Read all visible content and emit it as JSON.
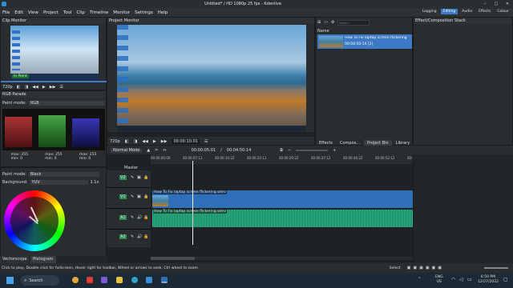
{
  "window": {
    "title": "Untitled* / HD 1080p 25 fps - Kdenlive"
  },
  "menu": [
    "File",
    "Edit",
    "View",
    "Project",
    "Tool",
    "Clip",
    "Timeline",
    "Monitor",
    "Settings",
    "Help"
  ],
  "workspaces": [
    "Logging",
    "Editing",
    "Audio",
    "Effects",
    "Colour"
  ],
  "workspace_active": "Editing",
  "clip_monitor": {
    "title": "Clip Monitor",
    "zoom": "720p",
    "overlay": "In Point"
  },
  "project_monitor": {
    "title": "Project Monitor",
    "zoom": "720p",
    "timecode": "00:00:10:01"
  },
  "search_placeholder": "Search...",
  "bin": {
    "column": "Name",
    "item_name": "How To Fix laptop screen flickering",
    "item_duration": "00:04:50:14 [2]"
  },
  "right_tabs": [
    "Effects",
    "Compos...",
    "Project Bin",
    "Library"
  ],
  "right_tab_active": "Project Bin",
  "effect_stack": {
    "title": "Effect/Composition Stack"
  },
  "rgb_parade": {
    "title": "RGB Parade",
    "paint_mode_label": "Paint mode:",
    "paint_mode_value": "RGB",
    "stats": [
      {
        "max_label": "max:",
        "max": "255",
        "min_label": "min:",
        "min": "0"
      },
      {
        "max_label": "max:",
        "max": "255",
        "min_label": "min:",
        "min": "0"
      },
      {
        "max_label": "max:",
        "max": "255",
        "min_label": "min:",
        "min": "0"
      }
    ]
  },
  "vectorscope": {
    "paint_mode_label": "Paint mode:",
    "paint_mode_value": "Black",
    "background_label": "Background:",
    "background_value": "YUV",
    "zoom": "1.1x"
  },
  "scope_tabs": [
    "Vectorscope",
    "Histogram"
  ],
  "scope_tab_active": "Histogram",
  "timeline": {
    "mode": "Normal Mode",
    "position": "00:00:05:01",
    "duration": "00:04:50:14",
    "master_label": "Master",
    "ruler_ticks": [
      "00:00:00:00",
      "00:00:07:11",
      "00:00:14:22",
      "00:00:22:11",
      "00:00:29:22",
      "00:00:37:12",
      "00:00:44:22",
      "00:00:52:12",
      "00:00:59"
    ],
    "tracks": [
      {
        "label": "V2"
      },
      {
        "label": "V1",
        "clip": "How To Fix laptop screen flickering.wmv"
      },
      {
        "label": "A1",
        "clip": "How To Fix laptop screen flickering.wmv"
      },
      {
        "label": "A2"
      }
    ]
  },
  "status": {
    "hint": "Click to play, Double click for fullscreen, Hover right for toolbar, Wheel or arrows to seek, Ctrl wheel to zoom",
    "select": "Select"
  },
  "taskbar": {
    "search": "Search",
    "lang": "ENG",
    "region": "US",
    "time": "6:50 PM",
    "date": "12/27/2022"
  }
}
